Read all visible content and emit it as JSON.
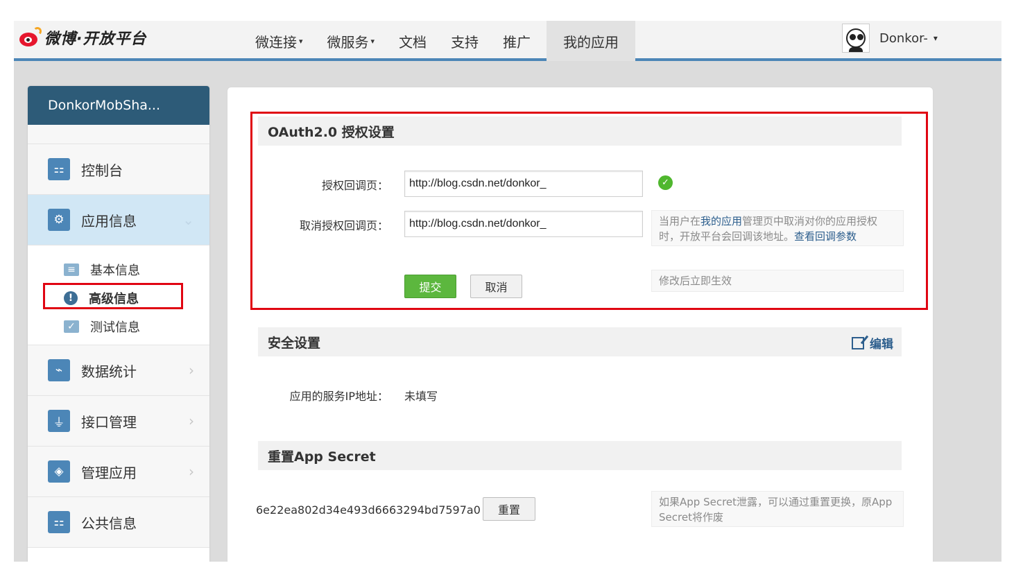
{
  "brand": {
    "logo_text": "微博·开放平台"
  },
  "nav": {
    "items": [
      {
        "label": "微连接",
        "caret": "▾"
      },
      {
        "label": "微服务",
        "caret": "▾"
      },
      {
        "label": "文档"
      },
      {
        "label": "支持"
      },
      {
        "label": "推广"
      },
      {
        "label": "我的应用"
      }
    ],
    "active_index": 5
  },
  "user": {
    "name": "Donkor-",
    "caret": "▾"
  },
  "sidebar": {
    "app_name": "DonkorMobSha...",
    "menu": [
      {
        "label": "控制台",
        "icon": "console-icon",
        "glyph": "⚏"
      },
      {
        "label": "应用信息",
        "icon": "gear-icon",
        "glyph": "⚙",
        "arrow": "⌄"
      },
      {
        "label": "数据统计",
        "icon": "chart-icon",
        "glyph": "⌁",
        "arrow": "›"
      },
      {
        "label": "接口管理",
        "icon": "plug-icon",
        "glyph": "⏚",
        "arrow": "›"
      },
      {
        "label": "管理应用",
        "icon": "layers-icon",
        "glyph": "◈",
        "arrow": "›"
      },
      {
        "label": "公共信息",
        "icon": "public-icon",
        "glyph": "⚏"
      }
    ],
    "submenu": [
      {
        "label": "基本信息",
        "icon": "card-icon",
        "glyph": "≡"
      },
      {
        "label": "高级信息",
        "icon": "exclamation-icon",
        "glyph": "!"
      },
      {
        "label": "测试信息",
        "icon": "test-card-icon",
        "glyph": "✓"
      }
    ]
  },
  "oauth": {
    "title": "OAuth2.0 授权设置",
    "redirect_label": "授权回调页：",
    "redirect_value": "http://blog.csdn.net/donkor_",
    "cancel_label": "取消授权回调页：",
    "cancel_value": "http://blog.csdn.net/donkor_",
    "cancel_hint_pre": "当用户在",
    "cancel_hint_link1": "我的应用",
    "cancel_hint_mid": "管理页中取消对你的应用授权时，开放平台会回调该地址。",
    "cancel_hint_link2": "查看回调参数",
    "submit_label": "提交",
    "cancel_btn_label": "取消",
    "effect_hint": "修改后立即生效",
    "ok_glyph": "✓"
  },
  "security": {
    "title": "安全设置",
    "edit_label": "编辑",
    "ip_label": "应用的服务IP地址：",
    "ip_value": "未填写"
  },
  "reset": {
    "title": "重置App Secret",
    "secret": "6e22ea802d34e493d6663294bd7597a0",
    "reset_label": "重置",
    "hint": "如果App Secret泄露，可以通过重置更换，原App Secret将作废"
  },
  "colors": {
    "accent": "#4c86b7",
    "app_header": "#2d5b78",
    "highlight": "#e00512",
    "success": "#5cb73e",
    "link": "#2c5e8d"
  }
}
